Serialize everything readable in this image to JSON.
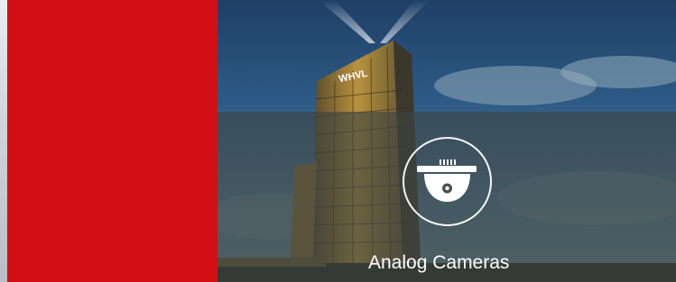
{
  "banner": {
    "category_label": "Analog Cameras",
    "icon": "dome-camera-icon",
    "sign_text": "WHVL"
  },
  "colors": {
    "red_panel": "#d20f14",
    "overlay": "#3e4342",
    "icon_stroke": "#ffffff",
    "label_text": "#ffffff"
  }
}
